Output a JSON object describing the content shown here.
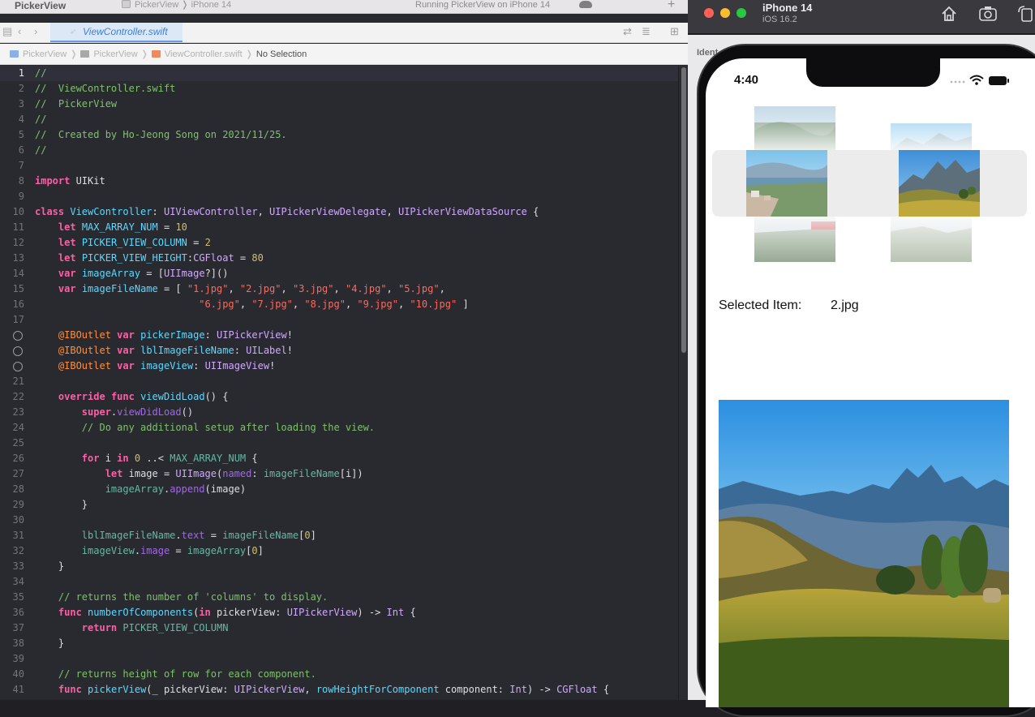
{
  "xcode": {
    "project_title": "PickerView",
    "scheme": {
      "project": "PickerView",
      "destination": "iPhone 14"
    },
    "status": "Running PickerView on iPhone 14",
    "tab": {
      "file": "ViewController.swift"
    },
    "jumpbar": [
      "PickerView",
      "PickerView",
      "ViewController.swift",
      "No Selection"
    ],
    "icons": [
      "navigator-icon",
      "back-icon",
      "forward-icon",
      "swift-file-icon",
      "related-files-icon",
      "adjust-editor-icon",
      "add-editor-icon",
      "cloud-icon",
      "add-icon"
    ],
    "current_line": 1,
    "code": [
      [
        [
          "cm",
          "//"
        ]
      ],
      [
        [
          "cm",
          "//  ViewController.swift"
        ]
      ],
      [
        [
          "cm",
          "//  PickerView"
        ]
      ],
      [
        [
          "cm",
          "//"
        ]
      ],
      [
        [
          "cm",
          "//  Created by Ho-Jeong Song on 2021/11/25."
        ]
      ],
      [
        [
          "cm",
          "//"
        ]
      ],
      [],
      [
        [
          "kw",
          "import"
        ],
        [
          "pl",
          " UIKit"
        ]
      ],
      [],
      [
        [
          "kw",
          "class"
        ],
        [
          "pl",
          " "
        ],
        [
          "nm",
          "ViewController"
        ],
        [
          "pl",
          ": "
        ],
        [
          "ty",
          "UIViewController"
        ],
        [
          "pl",
          ", "
        ],
        [
          "ty",
          "UIPickerViewDelegate"
        ],
        [
          "pl",
          ", "
        ],
        [
          "ty",
          "UIPickerViewDataSource"
        ],
        [
          "pl",
          " {"
        ]
      ],
      [
        [
          "pl",
          "    "
        ],
        [
          "kw",
          "let"
        ],
        [
          "pl",
          " "
        ],
        [
          "nm",
          "MAX_ARRAY_NUM"
        ],
        [
          "pl",
          " = "
        ],
        [
          "num",
          "10"
        ]
      ],
      [
        [
          "pl",
          "    "
        ],
        [
          "kw",
          "let"
        ],
        [
          "pl",
          " "
        ],
        [
          "nm",
          "PICKER_VIEW_COLUMN"
        ],
        [
          "pl",
          " = "
        ],
        [
          "num",
          "2"
        ]
      ],
      [
        [
          "pl",
          "    "
        ],
        [
          "kw",
          "let"
        ],
        [
          "pl",
          " "
        ],
        [
          "nm",
          "PICKER_VIEW_HEIGHT"
        ],
        [
          "pl",
          ":"
        ],
        [
          "ty",
          "CGFloat"
        ],
        [
          "pl",
          " = "
        ],
        [
          "num",
          "80"
        ]
      ],
      [
        [
          "pl",
          "    "
        ],
        [
          "kw",
          "var"
        ],
        [
          "pl",
          " "
        ],
        [
          "nm",
          "imageArray"
        ],
        [
          "pl",
          " = ["
        ],
        [
          "ty",
          "UIImage"
        ],
        [
          "pl",
          "?]()"
        ]
      ],
      [
        [
          "pl",
          "    "
        ],
        [
          "kw",
          "var"
        ],
        [
          "pl",
          " "
        ],
        [
          "nm",
          "imageFileName"
        ],
        [
          "pl",
          " = [ "
        ],
        [
          "st",
          "\"1.jpg\""
        ],
        [
          "pl",
          ", "
        ],
        [
          "st",
          "\"2.jpg\""
        ],
        [
          "pl",
          ", "
        ],
        [
          "st",
          "\"3.jpg\""
        ],
        [
          "pl",
          ", "
        ],
        [
          "st",
          "\"4.jpg\""
        ],
        [
          "pl",
          ", "
        ],
        [
          "st",
          "\"5.jpg\""
        ],
        [
          "pl",
          ","
        ]
      ],
      [
        [
          "pl",
          "                            "
        ],
        [
          "st",
          "\"6.jpg\""
        ],
        [
          "pl",
          ", "
        ],
        [
          "st",
          "\"7.jpg\""
        ],
        [
          "pl",
          ", "
        ],
        [
          "st",
          "\"8.jpg\""
        ],
        [
          "pl",
          ", "
        ],
        [
          "st",
          "\"9.jpg\""
        ],
        [
          "pl",
          ", "
        ],
        [
          "st",
          "\"10.jpg\""
        ],
        [
          "pl",
          " ]"
        ]
      ],
      [],
      [
        [
          "pl",
          "    "
        ],
        [
          "at",
          "@IBOutlet"
        ],
        [
          "pl",
          " "
        ],
        [
          "kw",
          "var"
        ],
        [
          "pl",
          " "
        ],
        [
          "nm",
          "pickerImage"
        ],
        [
          "pl",
          ": "
        ],
        [
          "ty",
          "UIPickerView"
        ],
        [
          "pl",
          "!"
        ]
      ],
      [
        [
          "pl",
          "    "
        ],
        [
          "at",
          "@IBOutlet"
        ],
        [
          "pl",
          " "
        ],
        [
          "kw",
          "var"
        ],
        [
          "pl",
          " "
        ],
        [
          "nm",
          "lblImageFileName"
        ],
        [
          "pl",
          ": "
        ],
        [
          "ty",
          "UILabel"
        ],
        [
          "pl",
          "!"
        ]
      ],
      [
        [
          "pl",
          "    "
        ],
        [
          "at",
          "@IBOutlet"
        ],
        [
          "pl",
          " "
        ],
        [
          "kw",
          "var"
        ],
        [
          "pl",
          " "
        ],
        [
          "nm",
          "imageView"
        ],
        [
          "pl",
          ": "
        ],
        [
          "ty",
          "UIImageView"
        ],
        [
          "pl",
          "!"
        ]
      ],
      [],
      [
        [
          "pl",
          "    "
        ],
        [
          "kw",
          "override"
        ],
        [
          "pl",
          " "
        ],
        [
          "kw",
          "func"
        ],
        [
          "pl",
          " "
        ],
        [
          "nm",
          "viewDidLoad"
        ],
        [
          "pl",
          "() {"
        ]
      ],
      [
        [
          "pl",
          "        "
        ],
        [
          "kw",
          "super"
        ],
        [
          "pl",
          "."
        ],
        [
          "fn",
          "viewDidLoad"
        ],
        [
          "pl",
          "()"
        ]
      ],
      [
        [
          "pl",
          "        "
        ],
        [
          "cm",
          "// Do any additional setup after loading the view."
        ]
      ],
      [],
      [
        [
          "pl",
          "        "
        ],
        [
          "kw",
          "for"
        ],
        [
          "pl",
          " i "
        ],
        [
          "kw",
          "in"
        ],
        [
          "pl",
          " "
        ],
        [
          "num",
          "0"
        ],
        [
          "pl",
          " ..< "
        ],
        [
          "pr",
          "MAX_ARRAY_NUM"
        ],
        [
          "pl",
          " {"
        ]
      ],
      [
        [
          "pl",
          "            "
        ],
        [
          "kw",
          "let"
        ],
        [
          "pl",
          " image = "
        ],
        [
          "ty",
          "UIImage"
        ],
        [
          "pl",
          "("
        ],
        [
          "fn",
          "named"
        ],
        [
          "pl",
          ": "
        ],
        [
          "pr",
          "imageFileName"
        ],
        [
          "pl",
          "[i])"
        ]
      ],
      [
        [
          "pl",
          "            "
        ],
        [
          "pr",
          "imageArray"
        ],
        [
          "pl",
          "."
        ],
        [
          "fn",
          "append"
        ],
        [
          "pl",
          "(image)"
        ]
      ],
      [
        [
          "pl",
          "        }"
        ]
      ],
      [],
      [
        [
          "pl",
          "        "
        ],
        [
          "pr",
          "lblImageFileName"
        ],
        [
          "pl",
          "."
        ],
        [
          "fn",
          "text"
        ],
        [
          "pl",
          " = "
        ],
        [
          "pr",
          "imageFileName"
        ],
        [
          "pl",
          "["
        ],
        [
          "num",
          "0"
        ],
        [
          "pl",
          "]"
        ]
      ],
      [
        [
          "pl",
          "        "
        ],
        [
          "pr",
          "imageView"
        ],
        [
          "pl",
          "."
        ],
        [
          "fn",
          "image"
        ],
        [
          "pl",
          " = "
        ],
        [
          "pr",
          "imageArray"
        ],
        [
          "pl",
          "["
        ],
        [
          "num",
          "0"
        ],
        [
          "pl",
          "]"
        ]
      ],
      [
        [
          "pl",
          "    }"
        ]
      ],
      [],
      [
        [
          "pl",
          "    "
        ],
        [
          "cm",
          "// returns the number of 'columns' to display."
        ]
      ],
      [
        [
          "pl",
          "    "
        ],
        [
          "kw",
          "func"
        ],
        [
          "pl",
          " "
        ],
        [
          "nm",
          "numberOfComponents"
        ],
        [
          "pl",
          "("
        ],
        [
          "kw",
          "in"
        ],
        [
          "pl",
          " pickerView: "
        ],
        [
          "ty",
          "UIPickerView"
        ],
        [
          "pl",
          ") -> "
        ],
        [
          "ty",
          "Int"
        ],
        [
          "pl",
          " {"
        ]
      ],
      [
        [
          "pl",
          "        "
        ],
        [
          "kw",
          "return"
        ],
        [
          "pl",
          " "
        ],
        [
          "pr",
          "PICKER_VIEW_COLUMN"
        ]
      ],
      [
        [
          "pl",
          "    }"
        ]
      ],
      [],
      [
        [
          "pl",
          "    "
        ],
        [
          "cm",
          "// returns height of row for each component."
        ]
      ],
      [
        [
          "pl",
          "    "
        ],
        [
          "kw",
          "func"
        ],
        [
          "pl",
          " "
        ],
        [
          "nm",
          "pickerView"
        ],
        [
          "pl",
          "(_ pickerView: "
        ],
        [
          "ty",
          "UIPickerView"
        ],
        [
          "pl",
          ", "
        ],
        [
          "nm",
          "rowHeightForComponent"
        ],
        [
          "pl",
          " component: "
        ],
        [
          "ty",
          "Int"
        ],
        [
          "pl",
          ") -> "
        ],
        [
          "ty",
          "CGFloat"
        ],
        [
          "pl",
          " {"
        ]
      ]
    ],
    "outlet_lines": [
      18,
      19,
      20
    ]
  },
  "simulator": {
    "device_name": "iPhone 14",
    "os_version": "iOS 16.2",
    "toolbar_icons": [
      "home-icon",
      "screenshot-icon",
      "rotate-icon"
    ],
    "behind_label": "Ident",
    "status_time": "4:40",
    "status_icons": [
      "signal-icon",
      "wifi-icon",
      "battery-icon"
    ],
    "selected_label": "Selected Item:",
    "selected_value": "2.jpg"
  },
  "colors": {
    "editor_bg": "#292a30",
    "comment": "#7ec16a",
    "keyword": "#fc5fa3",
    "string": "#fc6a5d",
    "type": "#d0a8ff",
    "declaration": "#5dd8ff",
    "number": "#d0bf69"
  }
}
